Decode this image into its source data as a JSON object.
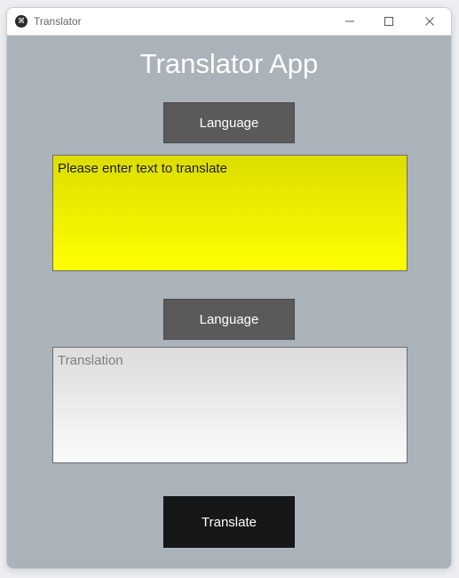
{
  "window": {
    "title": "Translator"
  },
  "app": {
    "title": "Translator App"
  },
  "buttons": {
    "language_top": "Language",
    "language_bottom": "Language",
    "translate": "Translate"
  },
  "source": {
    "text": "Please enter text to translate"
  },
  "translation": {
    "text": "Translation"
  },
  "icons": {
    "app": "app-icon",
    "minimize": "minimize-icon",
    "maximize": "maximize-icon",
    "close": "close-icon"
  },
  "colors": {
    "background": "#aab2ba",
    "source_box": "#ffff00",
    "language_button": "#5a5a5a",
    "translate_button": "#151719"
  }
}
